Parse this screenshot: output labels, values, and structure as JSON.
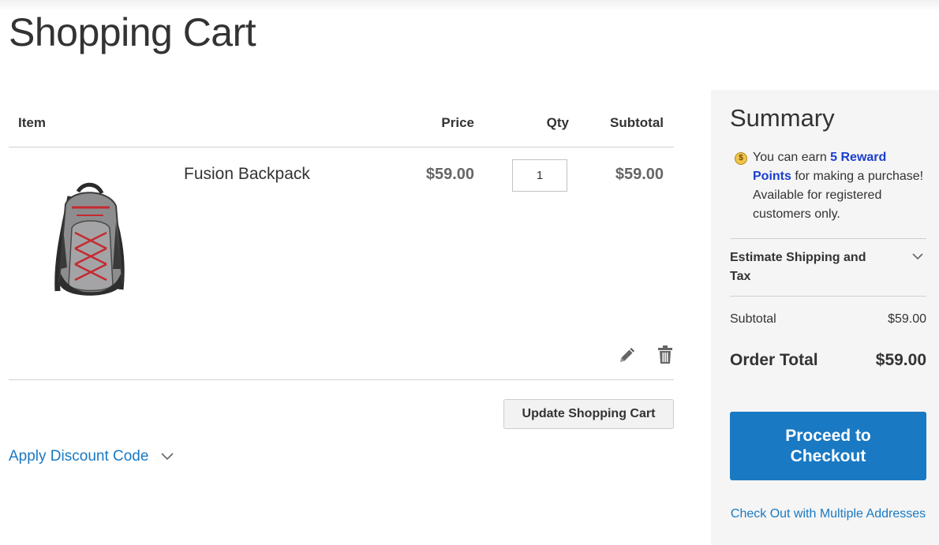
{
  "page": {
    "title": "Shopping Cart"
  },
  "cart": {
    "columns": {
      "item": "Item",
      "price": "Price",
      "qty": "Qty",
      "subtotal": "Subtotal"
    },
    "items": [
      {
        "name": "Fusion Backpack",
        "price": "$59.00",
        "qty": "1",
        "subtotal": "$59.00",
        "image_icon": "backpack-photo"
      }
    ],
    "actions": {
      "edit_icon": "pencil-icon",
      "delete_icon": "trash-icon"
    },
    "update_label": "Update Shopping Cart"
  },
  "discount": {
    "label": "Apply Discount Code"
  },
  "summary": {
    "title": "Summary",
    "reward": {
      "prefix": "You can earn ",
      "link": "5 Reward Points",
      "suffix": " for making a purchase! Available for registered customers only."
    },
    "estimate_label": "Estimate Shipping and Tax",
    "subtotal_label": "Subtotal",
    "subtotal_value": "$59.00",
    "total_label": "Order Total",
    "total_value": "$59.00",
    "checkout_label": "Proceed to Checkout",
    "multi_address_label": "Check Out with Multiple Addresses"
  },
  "colors": {
    "accent": "#1979c3",
    "reward_link": "#1a3fcf",
    "summary_bg": "#f5f5f5"
  }
}
